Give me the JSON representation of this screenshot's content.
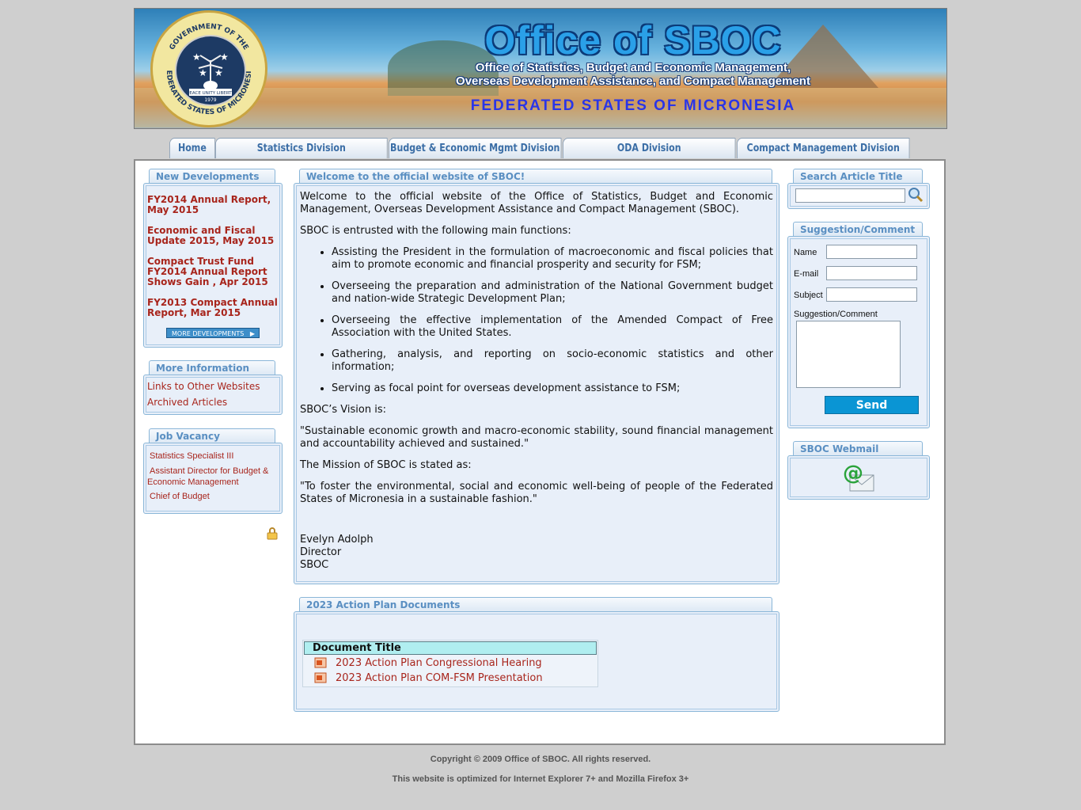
{
  "banner": {
    "title": "Office of SBOC",
    "subtitle_line1": "Office of Statistics, Budget and Economic Management,",
    "subtitle_line2": "Overseas Development Assistance, and Compact Management",
    "country": "FEDERATED STATES OF MICRONESIA",
    "seal_text_top": "GOVERNMENT OF THE",
    "seal_text_bottom": "FEDERATED STATES OF MICRONESIA",
    "seal_motto": "PEACE UNITY LIBERTY",
    "seal_year": "1979"
  },
  "nav": {
    "tabs": [
      {
        "label": "Home"
      },
      {
        "label": "Statistics Division"
      },
      {
        "label": "Budget & Economic Mgmt Division"
      },
      {
        "label": "ODA Division"
      },
      {
        "label": "Compact Management Division"
      }
    ]
  },
  "new_developments": {
    "header": "New Developments",
    "items": [
      {
        "line1": "FY2014 Annual Report,",
        "line2": "May 2015"
      },
      {
        "line1": "Economic and Fiscal",
        "line2": "Update 2015, May 2015"
      },
      {
        "line1": "Compact Trust Fund",
        "line2": "FY2014 Annual Report",
        "line3": "Shows Gain , Apr 2015"
      },
      {
        "line1": "FY2013 Compact Annual",
        "line2": "Report, Mar 2015"
      }
    ],
    "more_button": "MORE DEVELOPMENTS"
  },
  "more_information": {
    "header": "More Information",
    "links": [
      "Links to Other Websites",
      "Archived Articles"
    ]
  },
  "job_vacancy": {
    "header": "Job Vacancy",
    "items": [
      "Statistics Specialist III",
      "Assistant Director for Budget &",
      "Economic Management",
      "Chief of Budget"
    ]
  },
  "welcome": {
    "header": "Welcome to the official website of SBOC!",
    "intro": "Welcome to the official website of the Office of Statistics, Budget and Economic Management, Overseas Development Assistance and Compact Management (SBOC).",
    "functions_intro": "SBOC is entrusted with the following main functions:",
    "functions": [
      "Assisting the President in the formulation of macroeconomic and fiscal policies that aim to promote economic and financial prosperity and security for FSM;",
      "Overseeing the preparation and administration of the National Government budget and nation-wide Strategic Development Plan;",
      "Overseeing the effective implementation of the Amended Compact of Free Association with the United States.",
      "Gathering, analysis, and reporting on socio-economic statistics and other information;",
      "Serving as focal point for overseas development assistance to FSM;"
    ],
    "vision_label": "SBOC’s Vision is:",
    "vision": "\"Sustainable economic growth and macro-economic stability, sound financial management and accountability achieved and sustained.\"",
    "mission_label": "The Mission of SBOC is stated as:",
    "mission": "\"To foster the environmental, social and economic well-being of people of the Federated States of Micronesia in a sustainable fashion.\"",
    "signature_name": "Evelyn Adolph",
    "signature_title": "Director",
    "signature_org": "SBOC"
  },
  "action_plan": {
    "header": "2023 Action Plan Documents",
    "column_header": "Document Title",
    "documents": [
      "2023 Action Plan Congressional Hearing",
      "2023 Action Plan COM-FSM Presentation"
    ]
  },
  "search": {
    "header": "Search Article Title",
    "value": "",
    "placeholder": ""
  },
  "suggestion": {
    "header": "Suggestion/Comment",
    "name_label": "Name",
    "email_label": "E-mail",
    "subject_label": "Subject",
    "comment_label": "Suggestion/Comment",
    "send_label": "Send"
  },
  "webmail": {
    "header": "SBOC Webmail"
  },
  "footer": {
    "copyright": "Copyright © 2009 Office of SBOC. All rights reserved.",
    "optimized": "This website is optimized for Internet Explorer 7+ and Mozilla Firefox 3+"
  },
  "colors": {
    "link_red": "#a8251c",
    "panel_blue": "#e8eff9",
    "panel_border": "#8ab6d8",
    "header_text": "#5a8fc2",
    "send_button": "#0a95d4",
    "table_header": "#b0eef0"
  }
}
